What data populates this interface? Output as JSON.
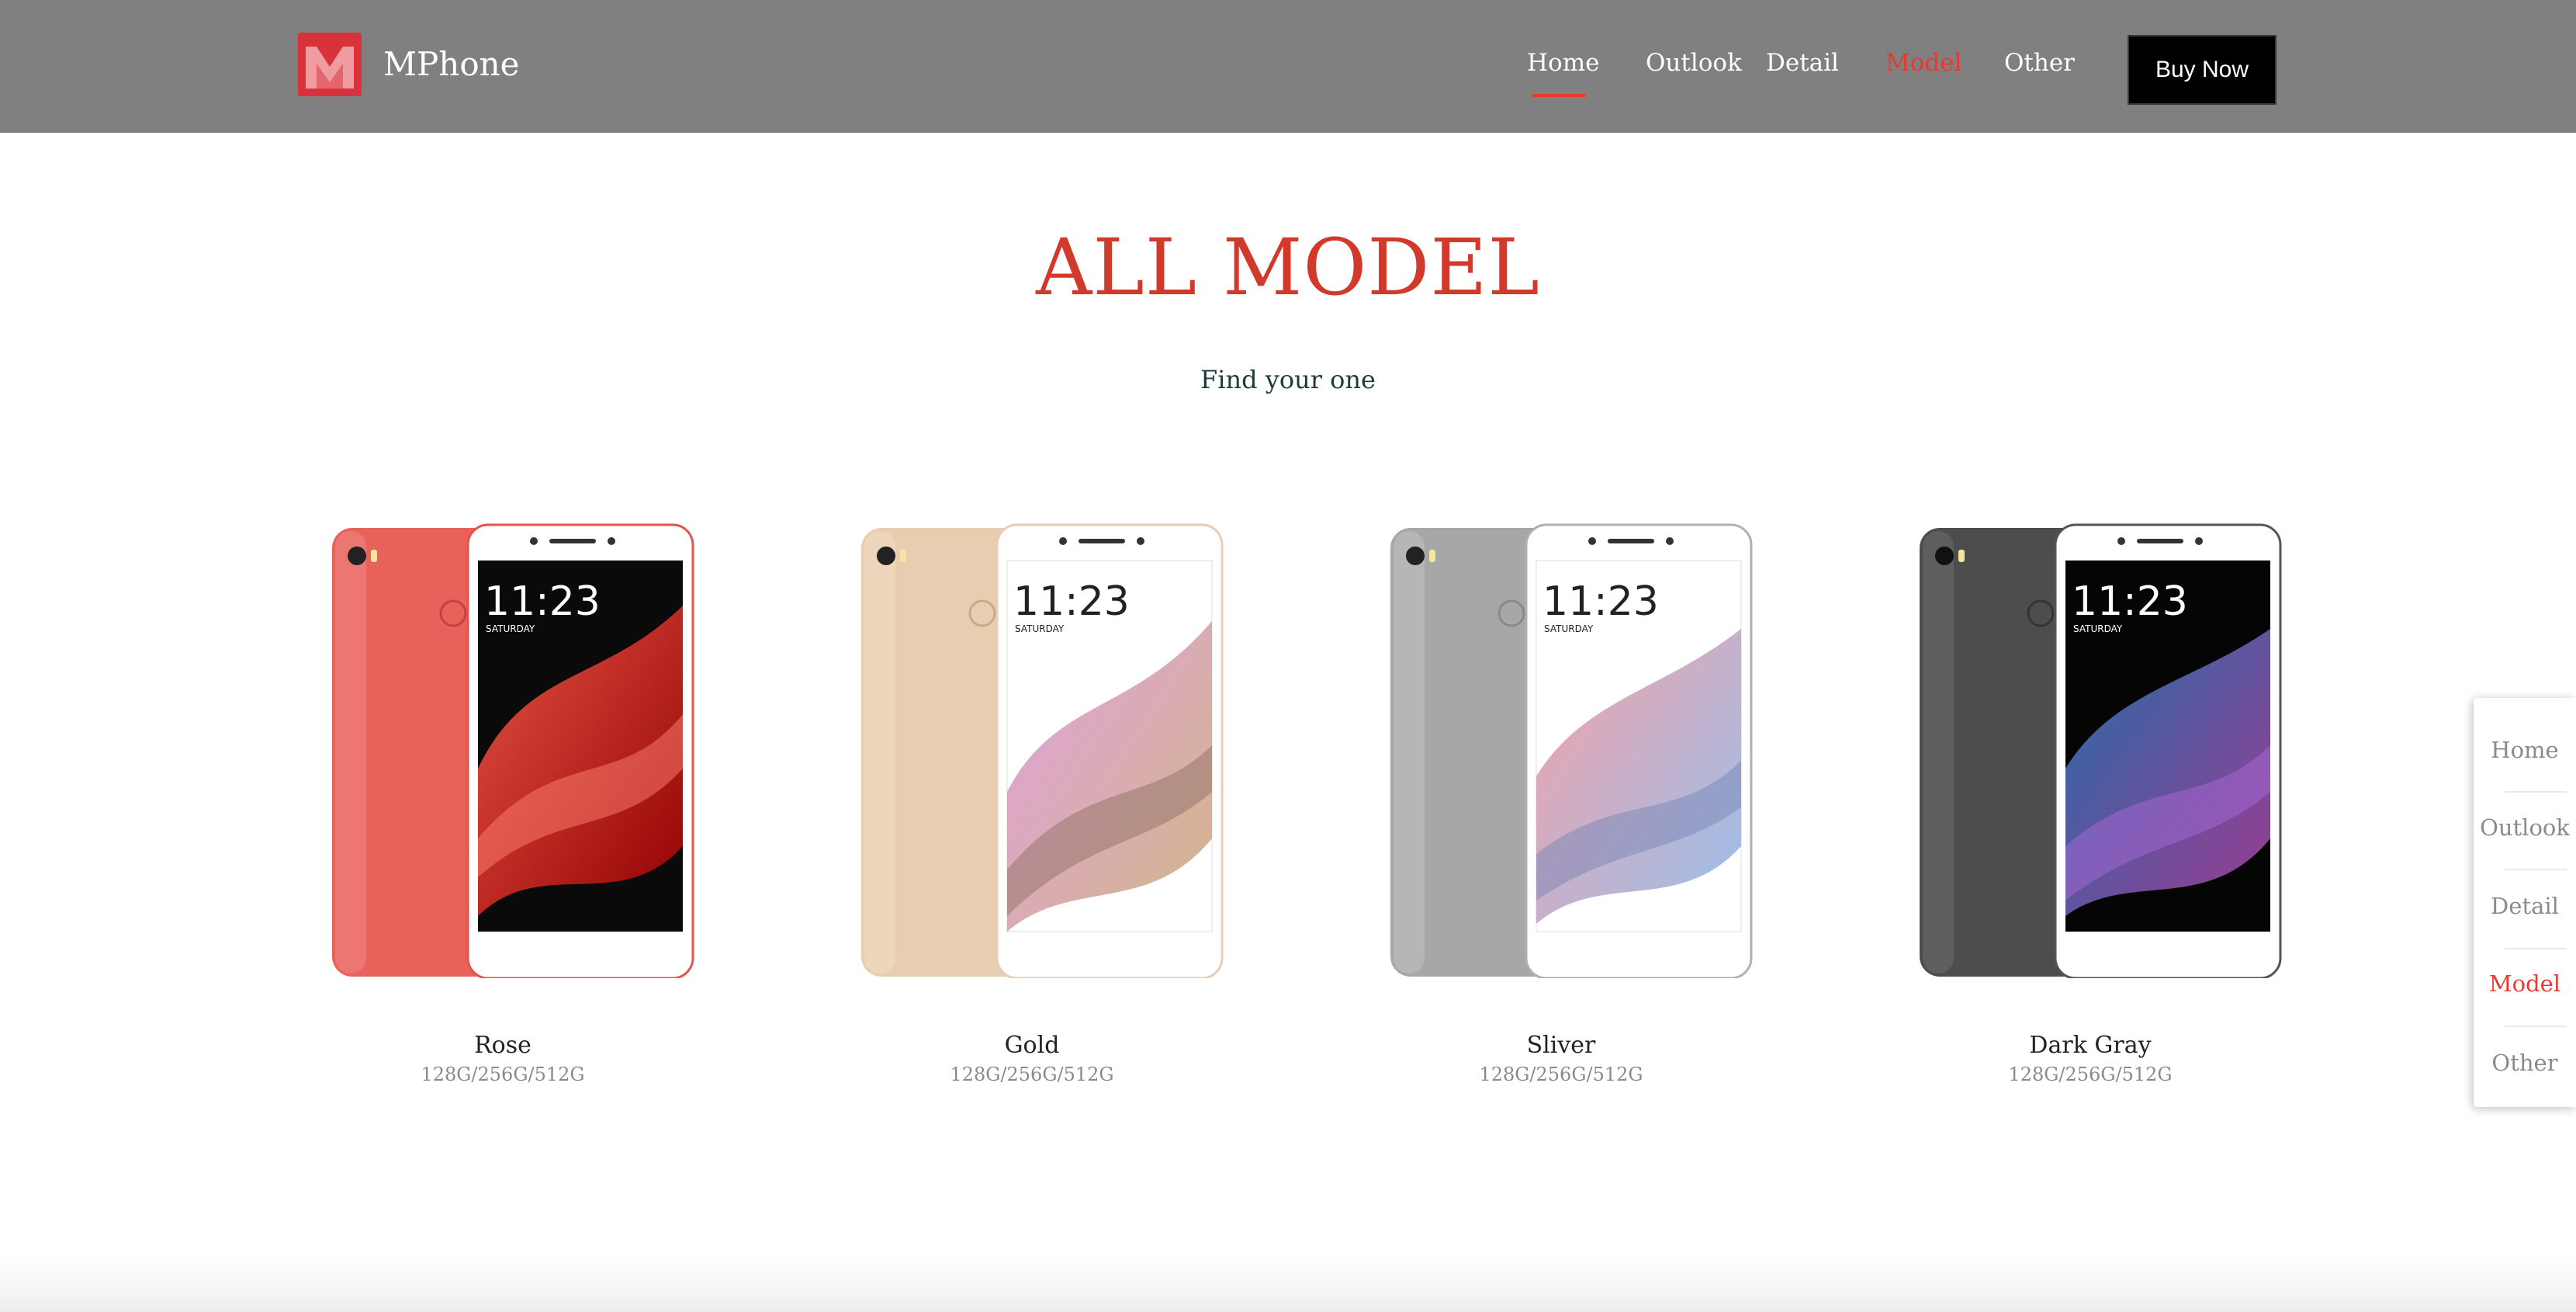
{
  "header": {
    "brand": "MPhone",
    "nav": [
      {
        "label": "Home"
      },
      {
        "label": "Outlook"
      },
      {
        "label": "Detail"
      },
      {
        "label": "Model"
      },
      {
        "label": "Other"
      }
    ],
    "active_nav": "Model",
    "underlined_nav": "Home",
    "buy_label": "Buy Now"
  },
  "main": {
    "title": "ALL MODEL",
    "subtitle": "Find your one",
    "models": [
      {
        "name": "Rose",
        "storage": "128G/256G/512G",
        "body_color": "#e8625c",
        "wallpaper": "red"
      },
      {
        "name": "Gold",
        "storage": "128G/256G/512G",
        "body_color": "#e9cdb0",
        "wallpaper": "white"
      },
      {
        "name": "Sliver",
        "storage": "128G/256G/512G",
        "body_color": "#a7a7a7",
        "wallpaper": "white"
      },
      {
        "name": "Dark Gray",
        "storage": "128G/256G/512G",
        "body_color": "#4d4d4d",
        "wallpaper": "black"
      }
    ],
    "screen": {
      "time": "11:23",
      "day": "SATURDAY"
    }
  },
  "side_nav": {
    "items": [
      {
        "label": "Home"
      },
      {
        "label": "Outlook"
      },
      {
        "label": "Detail"
      },
      {
        "label": "Model"
      },
      {
        "label": "Other"
      }
    ],
    "active": "Model"
  },
  "colors": {
    "accent": "#e63a2e",
    "title": "#d2392b",
    "header_bg": "#808080"
  }
}
